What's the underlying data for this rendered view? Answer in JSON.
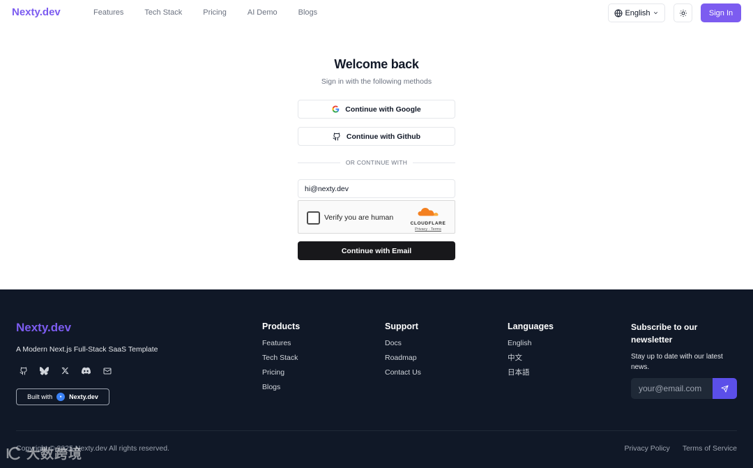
{
  "header": {
    "logo": "Nexty.dev",
    "nav": [
      "Features",
      "Tech Stack",
      "Pricing",
      "AI Demo",
      "Blogs"
    ],
    "language": "English",
    "sign_in": "Sign In"
  },
  "login": {
    "title": "Welcome back",
    "subtitle": "Sign in with the following methods",
    "google": "Continue with Google",
    "github": "Continue with Github",
    "divider": "OR CONTINUE WITH",
    "email_value": "hi@nexty.dev",
    "captcha_text": "Verify you are human",
    "captcha_brand": "CLOUDFLARE",
    "captcha_links": "Privacy · Terms",
    "email_button": "Continue with Email"
  },
  "footer": {
    "logo": "Nexty.dev",
    "tagline": "A Modern Next.js Full-Stack SaaS Template",
    "built_with": "Built with",
    "built_brand": "Nexty.dev",
    "products": {
      "title": "Products",
      "links": [
        "Features",
        "Tech Stack",
        "Pricing",
        "Blogs"
      ]
    },
    "support": {
      "title": "Support",
      "links": [
        "Docs",
        "Roadmap",
        "Contact Us"
      ]
    },
    "languages": {
      "title": "Languages",
      "links": [
        "English",
        "中文",
        "日本語"
      ]
    },
    "subscribe": {
      "title": "Subscribe to our newsletter",
      "text": "Stay up to date with our latest news.",
      "placeholder": "your@email.com"
    },
    "copyright": "Copyright © 2025 Nexty.dev All rights reserved.",
    "privacy": "Privacy Policy",
    "terms": "Terms of Service",
    "watermark": "大数跨境"
  },
  "colors": {
    "brand": "#7c5cf0",
    "footer_bg": "#101827",
    "primary_button": "#18181b",
    "subscribe_button": "#5b4fe9"
  }
}
